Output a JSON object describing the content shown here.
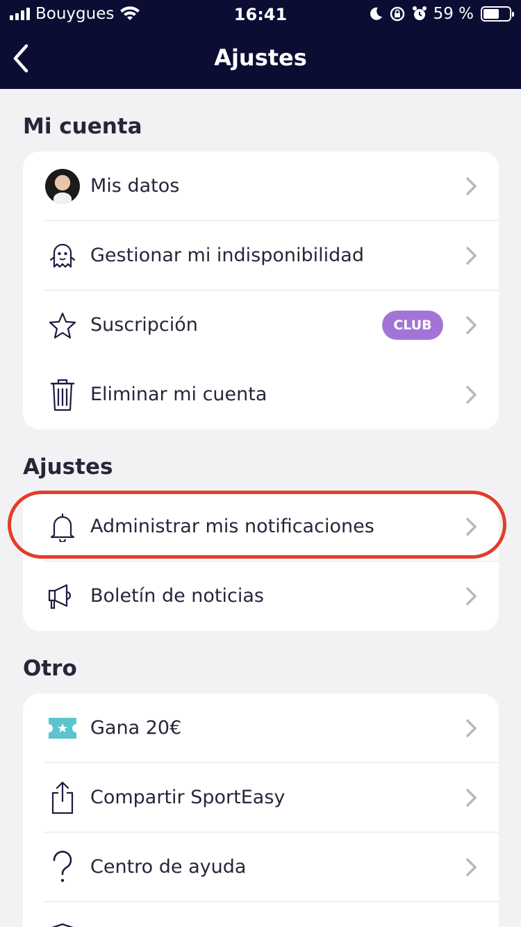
{
  "status_bar": {
    "carrier": "Bouygues",
    "time": "16:41",
    "battery": "59 %"
  },
  "nav": {
    "title": "Ajustes",
    "back_icon": "chevron-left-icon"
  },
  "sections": {
    "account": {
      "title": "Mi cuenta",
      "items": [
        {
          "label": "Mis datos",
          "icon": "avatar"
        },
        {
          "label": "Gestionar mi indisponibilidad",
          "icon": "ghost-icon"
        },
        {
          "label": "Suscripción",
          "icon": "star-icon",
          "badge": "CLUB"
        },
        {
          "label": "Eliminar mi cuenta",
          "icon": "trash-icon"
        }
      ]
    },
    "settings": {
      "title": "Ajustes",
      "items": [
        {
          "label": "Administrar mis notificaciones",
          "icon": "bell-icon"
        },
        {
          "label": "Boletín de noticias",
          "icon": "megaphone-icon"
        }
      ]
    },
    "other": {
      "title": "Otro",
      "items": [
        {
          "label": "Gana 20€",
          "icon": "ticket-icon"
        },
        {
          "label": "Compartir SportEasy",
          "icon": "share-icon"
        },
        {
          "label": "Centro de ayuda",
          "icon": "question-icon"
        }
      ]
    }
  },
  "colors": {
    "header_bg": "#0b0d33",
    "page_bg": "#f2f2f4",
    "badge": "#a374d6",
    "highlight": "#e33d2b",
    "ticket": "#5cc4cf"
  }
}
